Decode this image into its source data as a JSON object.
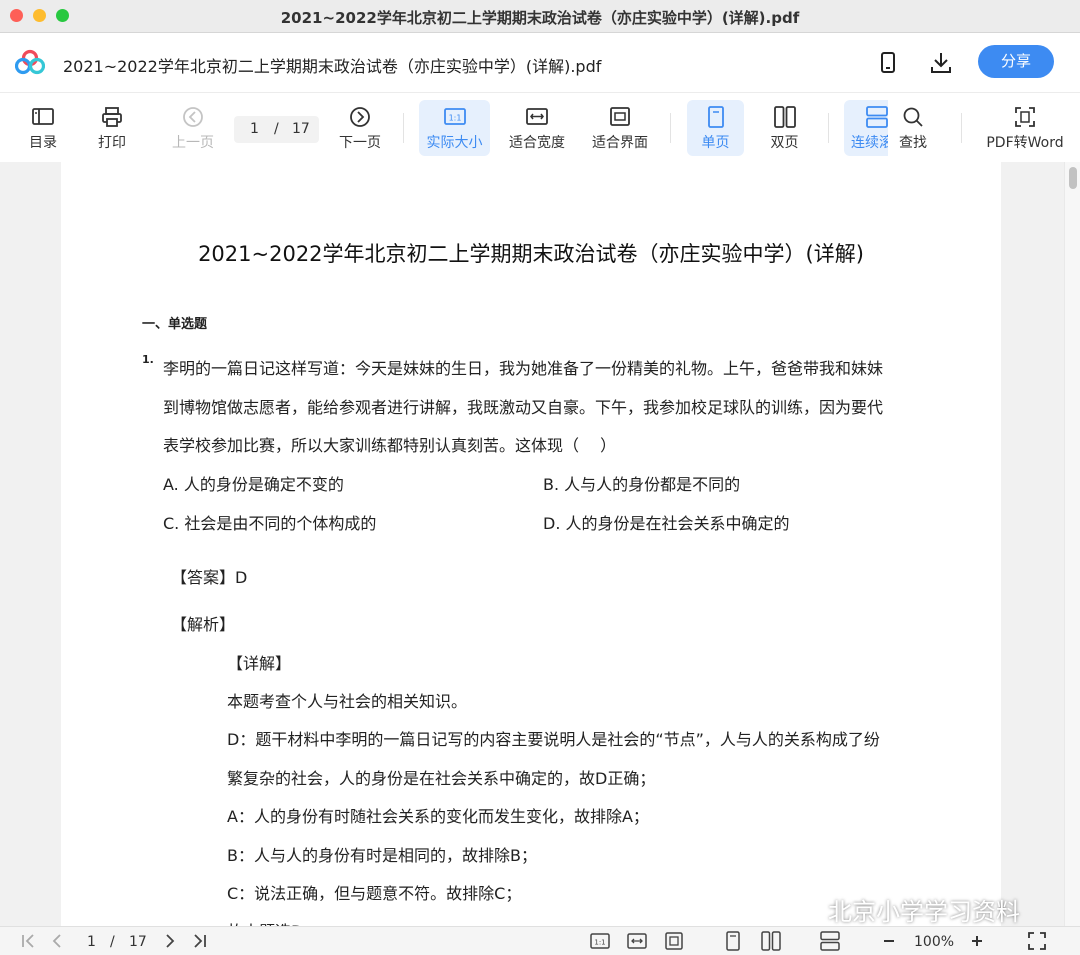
{
  "window": {
    "title": "2021~2022学年北京初二上学期期末政治试卷（亦庄实验中学）(详解).pdf"
  },
  "header": {
    "doc_title": "2021~2022学年北京初二上学期期末政治试卷（亦庄实验中学）(详解).pdf",
    "share_label": "分享"
  },
  "toolbar": {
    "toc": "目录",
    "print": "打印",
    "prev": "上一页",
    "page_current": "1",
    "page_sep": "/",
    "page_total": "17",
    "next": "下一页",
    "actual_size": "实际大小",
    "fit_width": "适合宽度",
    "fit_window": "适合界面",
    "single": "单页",
    "double": "双页",
    "continuous": "连续滚",
    "find": "查找",
    "pdf_to_word": "PDF转Word"
  },
  "document": {
    "title": "2021~2022学年北京初二上学期期末政治试卷（亦庄实验中学）(详解)",
    "section": "一、单选题",
    "q_number": "1.",
    "stem": [
      "李明的一篇日记这样写道：今天是妹妹的生日，我为她准备了一份精美的礼物。上午，爸爸带我和妹妹",
      "到博物馆做志愿者，能给参观者进行讲解，我既激动又自豪。下午，我参加校足球队的训练，因为要代",
      "表学校参加比赛，所以大家训练都特别认真刻苦。这体现（　 ）"
    ],
    "options": {
      "A": "A. 人的身份是确定不变的",
      "B": "B. 人与人的身份都是不同的",
      "C": "C. 社会是由不同的个体构成的",
      "D": "D. 人的身份是在社会关系中确定的"
    },
    "answer": "【答案】D",
    "analysis_head": "【解析】",
    "detail_head": "【详解】",
    "detail": [
      "本题考查个人与社会的相关知识。",
      "D：题干材料中李明的一篇日记写的内容主要说明人是社会的“节点”，人与人的关系构成了纷",
      "繁复杂的社会，人的身份是在社会关系中确定的，故D正确；",
      "A：人的身份有时随社会关系的变化而发生变化，故排除A；",
      "B：人与人的身份有时是相同的，故排除B；",
      "C：说法正确，但与题意不符。故排除C；",
      "故本题选D"
    ]
  },
  "footer": {
    "page_current": "1",
    "page_sep": "/",
    "page_total": "17",
    "zoom": "100%"
  },
  "watermark": {
    "text": "北京小学学习资料"
  },
  "colors": {
    "accent": "#3d8bf2",
    "active_bg": "#e6f0fd"
  }
}
